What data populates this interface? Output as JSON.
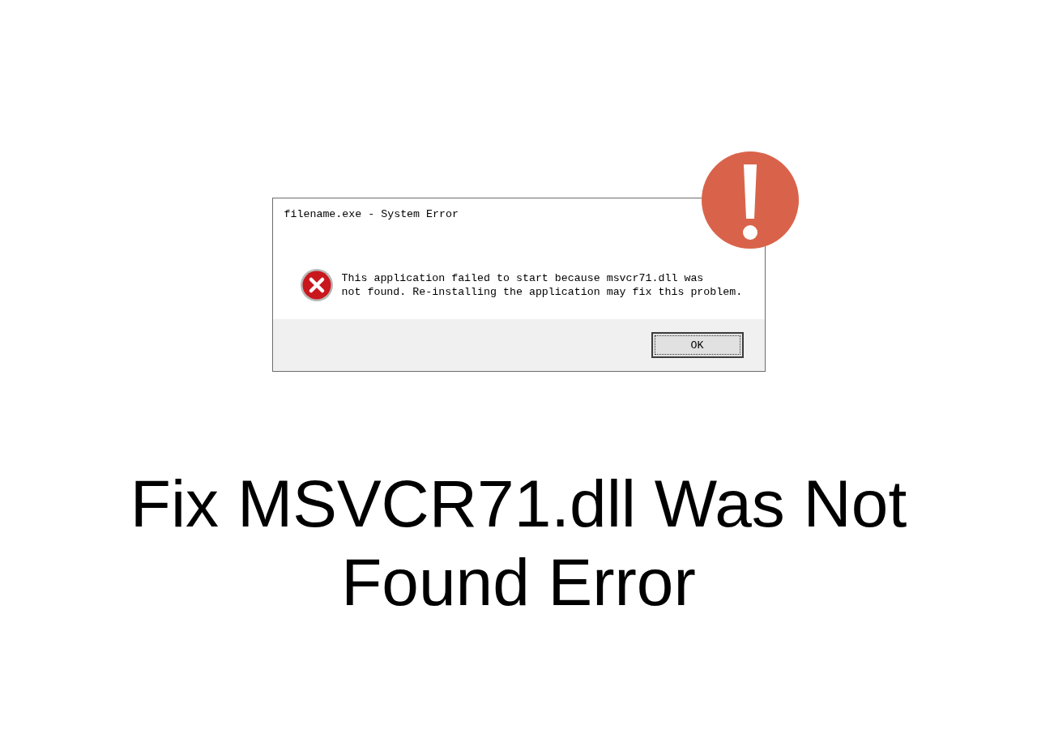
{
  "dialog": {
    "title": "filename.exe - System Error",
    "message_lines": [
      "This application failed to start because msvcr71.dll was",
      "not found. Re-installing the application may fix this problem."
    ],
    "buttons": [
      {
        "label": "OK",
        "selected": true
      }
    ]
  },
  "headline_lines": [
    "Fix MSVCR71.dll Was Not",
    "Found Error"
  ]
}
